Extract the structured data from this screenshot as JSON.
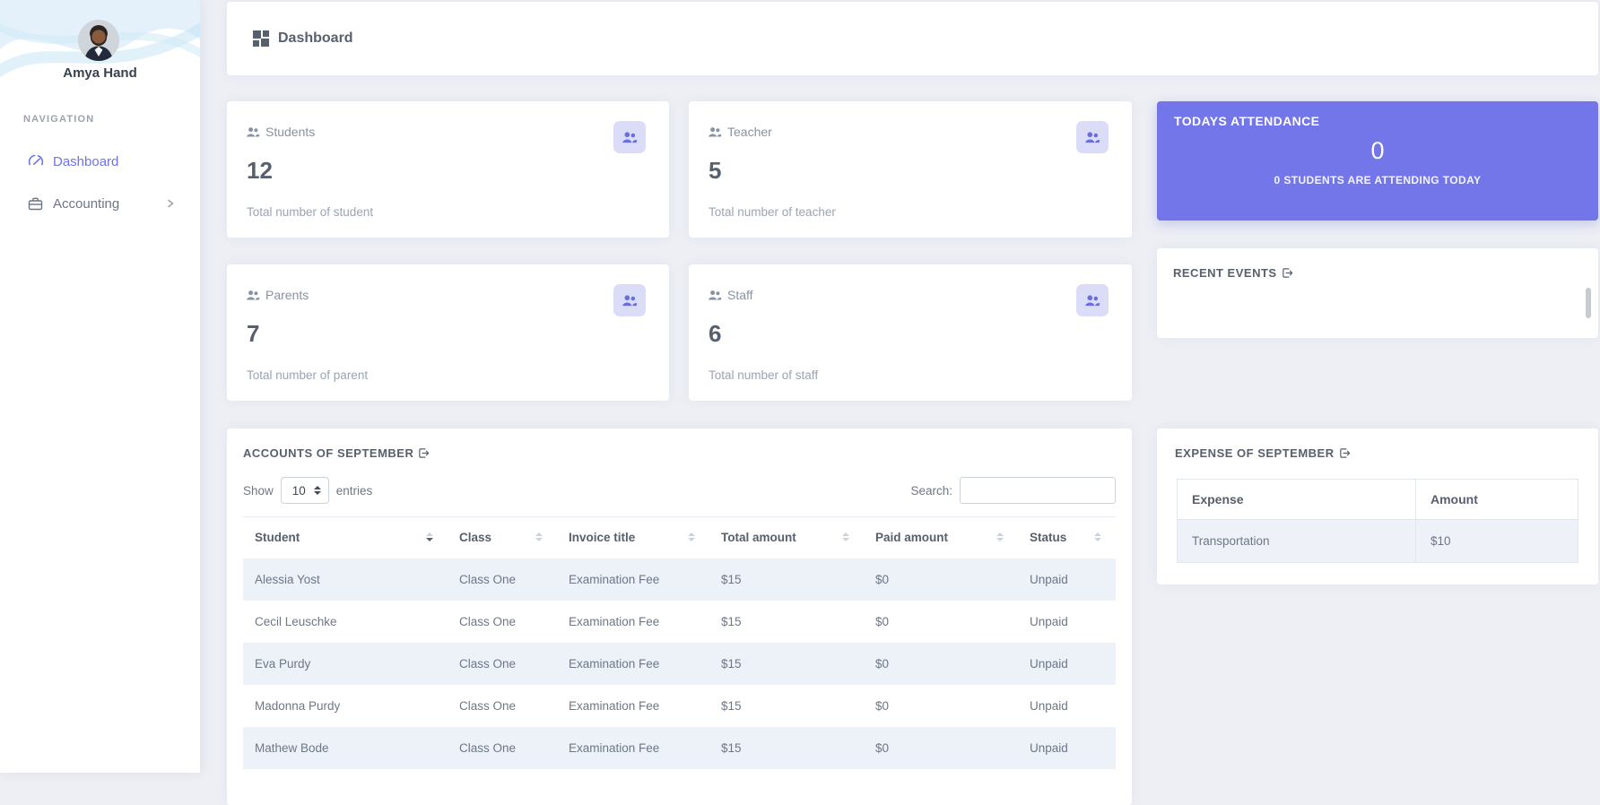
{
  "sidebar": {
    "user_name": "Amya Hand",
    "nav_section_label": "NAVIGATION",
    "items": [
      {
        "label": "Dashboard"
      },
      {
        "label": "Accounting"
      }
    ]
  },
  "header": {
    "title": "Dashboard"
  },
  "stats": [
    {
      "label": "Students",
      "value": "12",
      "caption": "Total number of student"
    },
    {
      "label": "Teacher",
      "value": "5",
      "caption": "Total number of teacher"
    },
    {
      "label": "Parents",
      "value": "7",
      "caption": "Total number of parent"
    },
    {
      "label": "Staff",
      "value": "6",
      "caption": "Total number of staff"
    }
  ],
  "attendance": {
    "title": "TODAYS ATTENDANCE",
    "count": "0",
    "caption": "0 STUDENTS ARE ATTENDING TODAY"
  },
  "recent_events": {
    "title": "RECENT EVENTS"
  },
  "accounts": {
    "title": "ACCOUNTS OF SEPTEMBER",
    "show_label": "Show",
    "page_size": "10",
    "entries_label": "entries",
    "search_label": "Search:",
    "search_value": "",
    "columns": [
      "Student",
      "Class",
      "Invoice title",
      "Total amount",
      "Paid amount",
      "Status"
    ],
    "rows": [
      {
        "student": "Alessia Yost",
        "class": "Class One",
        "invoice": "Examination Fee",
        "total": "$15",
        "paid": "$0",
        "status": "Unpaid"
      },
      {
        "student": "Cecil Leuschke",
        "class": "Class One",
        "invoice": "Examination Fee",
        "total": "$15",
        "paid": "$0",
        "status": "Unpaid"
      },
      {
        "student": "Eva Purdy",
        "class": "Class One",
        "invoice": "Examination Fee",
        "total": "$15",
        "paid": "$0",
        "status": "Unpaid"
      },
      {
        "student": "Madonna Purdy",
        "class": "Class One",
        "invoice": "Examination Fee",
        "total": "$15",
        "paid": "$0",
        "status": "Unpaid"
      },
      {
        "student": "Mathew Bode",
        "class": "Class One",
        "invoice": "Examination Fee",
        "total": "$15",
        "paid": "$0",
        "status": "Unpaid"
      }
    ]
  },
  "expense": {
    "title": "EXPENSE OF SEPTEMBER",
    "columns": [
      "Expense",
      "Amount"
    ],
    "rows": [
      {
        "name": "Transportation",
        "amount": "$10"
      }
    ]
  },
  "colors": {
    "accent": "#7276e8",
    "attendance_bg": "#7276e8",
    "icon_badge_bg": "#dbddf8",
    "icon_badge_fg": "#686de0",
    "table_stripe": "#edf1f8"
  }
}
